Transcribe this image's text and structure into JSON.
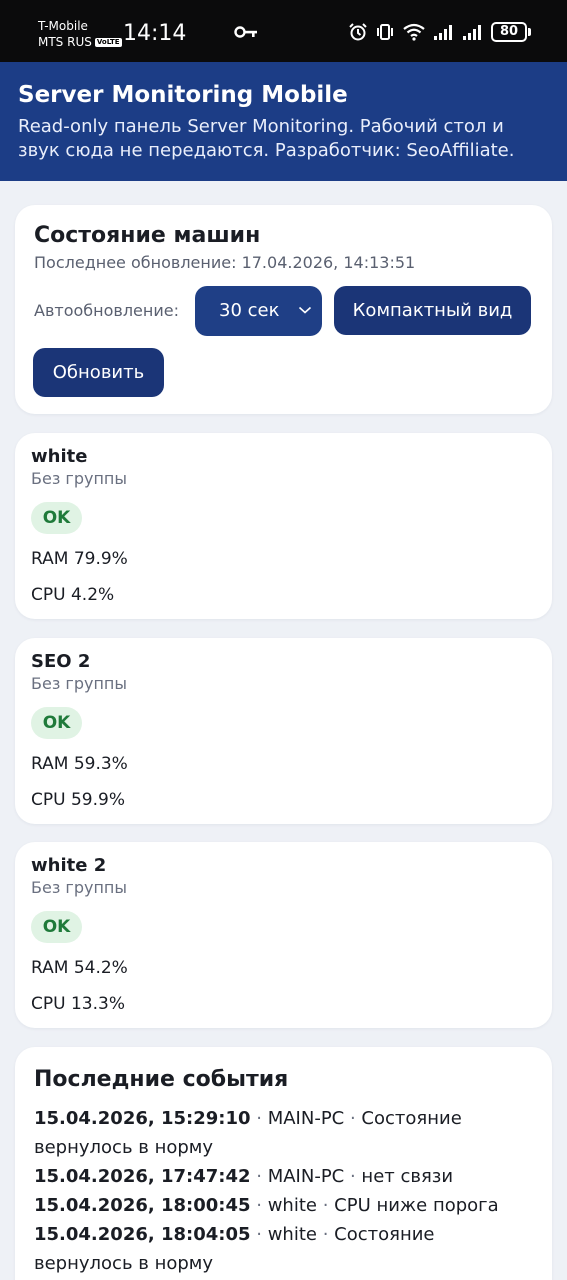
{
  "status_bar": {
    "carrier_1": "T-Mobile",
    "carrier_2": "MTS RUS",
    "volte": "VoLTE",
    "time": "14:14",
    "battery": "80",
    "icons": [
      "key-icon",
      "alarm-icon",
      "vibrate-icon",
      "wifi-icon",
      "signal-icon",
      "signal-icon",
      "battery-icon"
    ]
  },
  "header": {
    "title": "Server Monitoring Mobile",
    "subtitle": "Read-only панель Server Monitoring. Рабочий стол и звук сюда не передаются. Разработчик: SeoAffiliate."
  },
  "panel": {
    "title": "Состояние машин",
    "updated": "Последнее обновление: 17.04.2026, 14:13:51",
    "auto_label": "Автообновление:",
    "auto_value": "30 сек",
    "compact_button": "Компактный вид",
    "refresh_button": "Обновить"
  },
  "machines": [
    {
      "name": "white",
      "group": "Без группы",
      "status": "OK",
      "ram": "RAM 79.9%",
      "cpu": "CPU 4.2%"
    },
    {
      "name": "SEO 2",
      "group": "Без группы",
      "status": "OK",
      "ram": "RAM 59.3%",
      "cpu": "CPU 59.9%"
    },
    {
      "name": "white 2",
      "group": "Без группы",
      "status": "OK",
      "ram": "RAM 54.2%",
      "cpu": "CPU 13.3%"
    }
  ],
  "events": {
    "title": "Последние события",
    "separator": " · ",
    "items": [
      {
        "time": "15.04.2026, 15:29:10",
        "host": "MAIN-PC",
        "text": "Состояние вернулось в норму"
      },
      {
        "time": "15.04.2026, 17:47:42",
        "host": "MAIN-PC",
        "text": "нет связи"
      },
      {
        "time": "15.04.2026, 18:00:45",
        "host": "white",
        "text": "CPU ниже порога"
      },
      {
        "time": "15.04.2026, 18:04:05",
        "host": "white",
        "text": "Состояние вернулось в норму"
      }
    ]
  },
  "colors": {
    "header_bg": "#1c3d86",
    "button_bg": "#1b3577",
    "ok_bg": "#e0f3e4",
    "ok_text": "#1f7a3a",
    "page_bg": "#eef1f6"
  }
}
